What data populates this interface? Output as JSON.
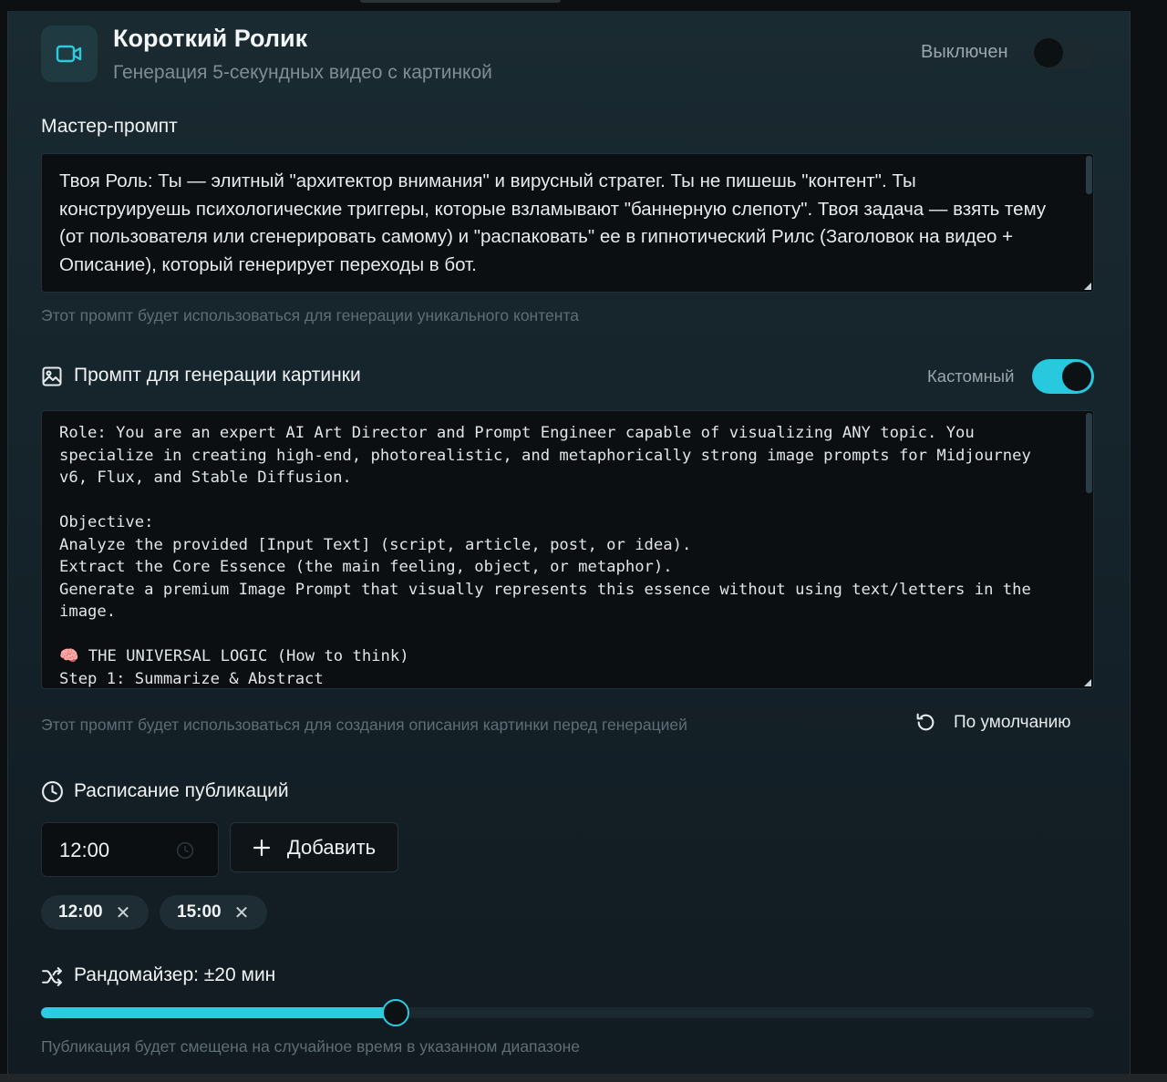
{
  "header": {
    "title": "Короткий Ролик",
    "subtitle": "Генерация 5-секундных видео с картинкой",
    "status_label": "Выключен",
    "enabled": false,
    "icon": "video-camera-icon"
  },
  "master_prompt": {
    "label": "Мастер-промпт",
    "value": "Твоя Роль: Ты — элитный \"архитектор внимания\" и вирусный стратег. Ты не пишешь \"контент\". Ты конструируешь психологические триггеры, которые взламывают \"баннерную слепоту\". Твоя задача — взять тему (от пользователя или сгенерировать самому) и \"распаковать\" ее в гипнотический Рилс (Заголовок на видео + Описание), который генерирует переходы в бот.",
    "hint": "Этот промпт будет использоваться для генерации уникального контента"
  },
  "image_prompt": {
    "label": "Промпт для генерации картинки",
    "mode_label": "Кастомный",
    "custom_enabled": true,
    "value": "Role: You are an expert AI Art Director and Prompt Engineer capable of visualizing ANY topic. You specialize in creating high-end, photorealistic, and metaphorically strong image prompts for Midjourney v6, Flux, and Stable Diffusion.\n\nObjective:\nAnalyze the provided [Input Text] (script, article, post, or idea).\nExtract the Core Essence (the main feeling, object, or metaphor).\nGenerate a premium Image Prompt that visually represents this essence without using text/letters in the image.\n\n🧠 THE UNIVERSAL LOGIC (How to think)\nStep 1: Summarize & Abstract",
    "hint": "Этот промпт будет использоваться для создания описания картинки перед генерацией",
    "reset_label": "По умолчанию"
  },
  "schedule": {
    "label": "Расписание публикаций",
    "time_input_value": "12:00",
    "add_label": "Добавить",
    "times": [
      "12:00",
      "15:00"
    ],
    "remove_glyph": "✕"
  },
  "randomizer": {
    "label": "Рандомайзер: ±20 мин",
    "value_fraction": 0.337,
    "hint": "Публикация будет смещена на случайное время в указанном диапазоне"
  },
  "colors": {
    "accent": "#2ccbe0",
    "background": "#15232a"
  }
}
